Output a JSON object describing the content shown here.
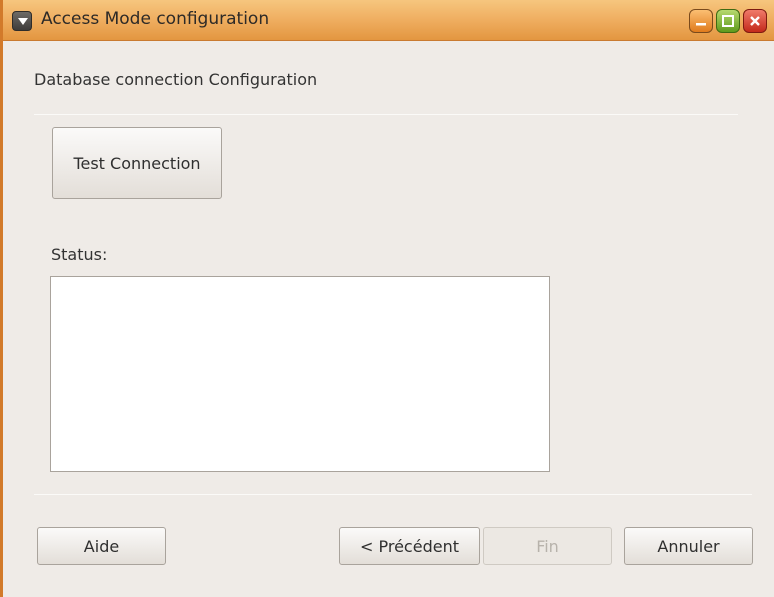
{
  "window": {
    "title": "Access Mode configuration"
  },
  "content": {
    "section_title": "Database connection Configuration",
    "test_button_label": "Test Connection",
    "status_label": "Status:",
    "status_text": ""
  },
  "footer": {
    "help_label": "Aide",
    "previous_label": "< Précédent",
    "finish_label": "Fin",
    "cancel_label": "Annuler"
  },
  "icons": {
    "menu": "window-menu-icon",
    "minimize": "minimize-icon",
    "maximize": "maximize-icon",
    "close": "close-icon"
  },
  "colors": {
    "titlebar": "#f0b063",
    "frame": "#d27a2a",
    "background": "#efebe7"
  }
}
